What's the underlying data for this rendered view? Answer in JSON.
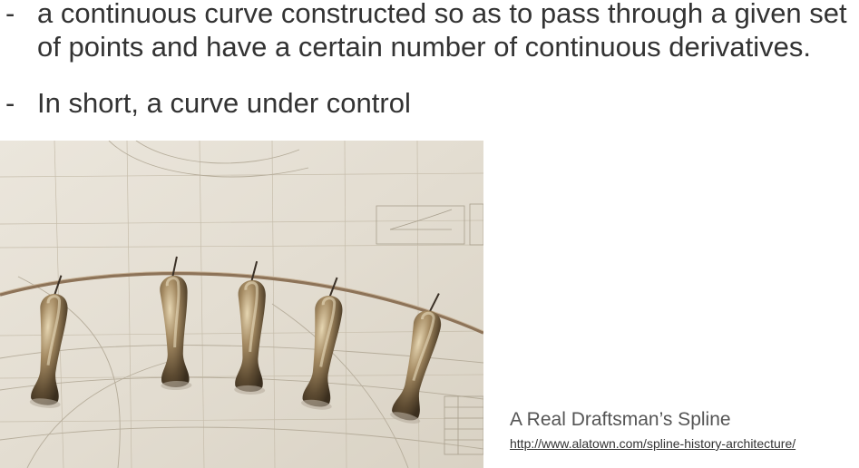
{
  "bullets": [
    {
      "marker": "-",
      "lines": [
        "a continuous curve constructed so as to pass through a given set",
        "of points and have a certain number of continuous derivatives."
      ]
    },
    {
      "marker": "-",
      "lines": [
        "In short, a curve under control"
      ]
    }
  ],
  "figure": {
    "caption": "A Real Draftsman’s Spline",
    "url": "http://www.alatown.com/spline-history-architecture/",
    "colors": {
      "paper": "#e4ded2",
      "drafting_lines": "#b6ad9b",
      "spline_strip": "#8d7358",
      "duck_metal": "#7a6646"
    }
  }
}
